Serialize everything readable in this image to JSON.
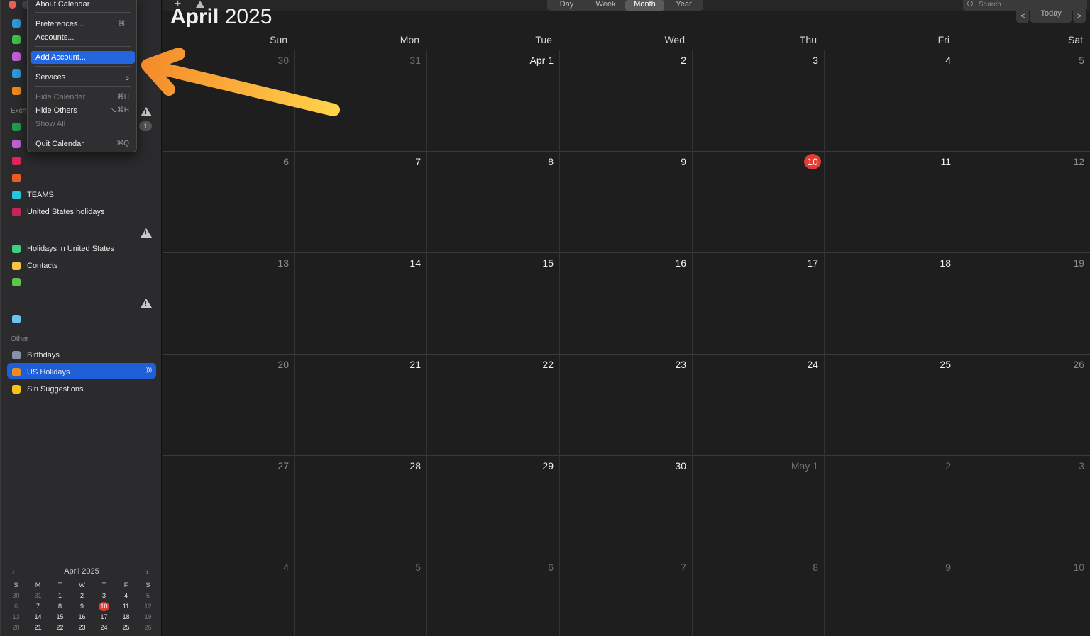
{
  "menu": {
    "about": "About Calendar",
    "preferences": "Preferences...",
    "preferences_sc": "⌘ ,",
    "accounts": "Accounts...",
    "add_account": "Add Account...",
    "services": "Services",
    "services_arrow": "›",
    "hide_calendar": "Hide Calendar",
    "hide_calendar_sc": "⌘H",
    "hide_others": "Hide Others",
    "hide_others_sc": "⌥⌘H",
    "show_all": "Show All",
    "quit": "Quit Calendar",
    "quit_sc": "⌘Q"
  },
  "sidebar": {
    "exchange_label": "Exch",
    "other_label": "Other",
    "badge": "1",
    "calendars": [
      {
        "name": "",
        "color": "#2d9ad6"
      },
      {
        "name": "",
        "color": "#3ec24a"
      },
      {
        "name": "",
        "color": "#c062d6"
      },
      {
        "name": "",
        "color": "#2d9ad6"
      },
      {
        "name": "",
        "color": "#f28a1a"
      },
      {
        "name": "",
        "color": "#1f9e4e"
      },
      {
        "name": "",
        "color": "#c062d6"
      },
      {
        "name": "",
        "color": "#e3245b"
      },
      {
        "name": "",
        "color": "#ee5a24"
      },
      {
        "name": "TEAMS",
        "color": "#28c3e0"
      },
      {
        "name": "United States holidays",
        "color": "#c9235a"
      },
      {
        "name": "Holidays in United States",
        "color": "#3dd07e"
      },
      {
        "name": "Contacts",
        "color": "#f5c542"
      },
      {
        "name": "",
        "color": "#5ec44a"
      },
      {
        "name": "",
        "color": "#6ac4ee"
      },
      {
        "name": "Birthdays",
        "color": "#8a8fa8"
      },
      {
        "name": "US Holidays",
        "color": "#f28a1a"
      },
      {
        "name": "Siri Suggestions",
        "color": "#f5c518"
      }
    ],
    "broadcast_icon": ")))"
  },
  "mini": {
    "title": "April 2025",
    "prev": "‹",
    "next": "›",
    "headers": [
      "S",
      "M",
      "T",
      "W",
      "T",
      "F",
      "S"
    ],
    "rows": [
      [
        "30",
        "31",
        "1",
        "2",
        "3",
        "4",
        "5"
      ],
      [
        "6",
        "7",
        "8",
        "9",
        "10",
        "11",
        "12"
      ],
      [
        "13",
        "14",
        "15",
        "16",
        "17",
        "18",
        "19"
      ],
      [
        "20",
        "21",
        "22",
        "23",
        "24",
        "25",
        "26"
      ]
    ]
  },
  "toolbar": {
    "add": "+",
    "views": [
      "Day",
      "Week",
      "Month",
      "Year"
    ],
    "active_view": "Month",
    "search_placeholder": "Search",
    "prev": "<",
    "today": "Today",
    "next": ">"
  },
  "main": {
    "month": "April",
    "year": "2025",
    "weekdays": [
      "Sun",
      "Mon",
      "Tue",
      "Wed",
      "Thu",
      "Fri",
      "Sat"
    ],
    "weeks": [
      [
        "30",
        "31",
        "Apr 1",
        "2",
        "3",
        "4",
        "5"
      ],
      [
        "6",
        "7",
        "8",
        "9",
        "10",
        "11",
        "12"
      ],
      [
        "13",
        "14",
        "15",
        "16",
        "17",
        "18",
        "19"
      ],
      [
        "20",
        "21",
        "22",
        "23",
        "24",
        "25",
        "26"
      ],
      [
        "27",
        "28",
        "29",
        "30",
        "May 1",
        "2",
        "3"
      ],
      [
        "4",
        "5",
        "6",
        "7",
        "8",
        "9",
        "10"
      ]
    ],
    "today": "10"
  },
  "colors": {
    "accent": "#1e5fd8",
    "today": "#e33c34",
    "arrow_start": "#f58a2a",
    "arrow_end": "#ffd34a"
  }
}
